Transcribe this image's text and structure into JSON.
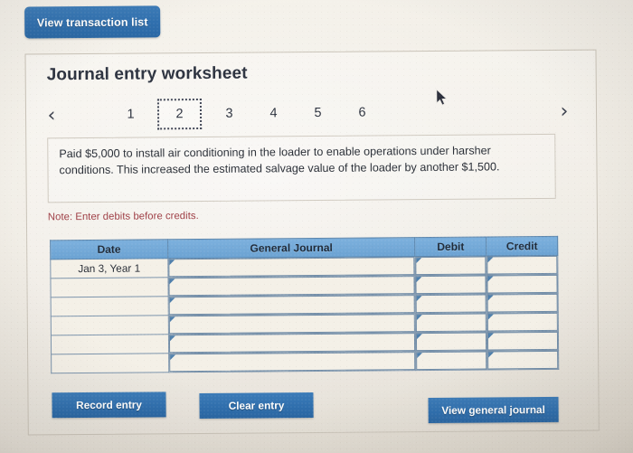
{
  "top_actions": {
    "view_transaction_list": "View transaction list"
  },
  "panel": {
    "title": "Journal entry worksheet"
  },
  "pager": {
    "prev_icon": "chevron-left-icon",
    "next_icon": "chevron-right-icon",
    "pages": [
      "1",
      "2",
      "3",
      "4",
      "5",
      "6"
    ],
    "selected": "2"
  },
  "transaction": {
    "text": "Paid $5,000 to install air conditioning in the loader to enable operations under harsher conditions. This increased the estimated salvage value of the loader by another $1,500."
  },
  "note": {
    "text": "Note: Enter debits before credits."
  },
  "journal_table": {
    "headers": [
      "Date",
      "General Journal",
      "Debit",
      "Credit"
    ],
    "rows": [
      {
        "date": "Jan 3, Year 1",
        "general_journal": "",
        "debit": "",
        "credit": ""
      },
      {
        "date": "",
        "general_journal": "",
        "debit": "",
        "credit": ""
      },
      {
        "date": "",
        "general_journal": "",
        "debit": "",
        "credit": ""
      },
      {
        "date": "",
        "general_journal": "",
        "debit": "",
        "credit": ""
      },
      {
        "date": "",
        "general_journal": "",
        "debit": "",
        "credit": ""
      },
      {
        "date": "",
        "general_journal": "",
        "debit": "",
        "credit": ""
      }
    ]
  },
  "buttons": {
    "record_entry": "Record entry",
    "clear_entry": "Clear entry",
    "view_general_journal": "View general journal"
  },
  "colors": {
    "header_blue": "#6ba2d2",
    "button_blue": "#2f6fae",
    "note_red": "#9e3d44",
    "page_background": "#ece8e0",
    "cell_background": "#f4f0e7"
  }
}
